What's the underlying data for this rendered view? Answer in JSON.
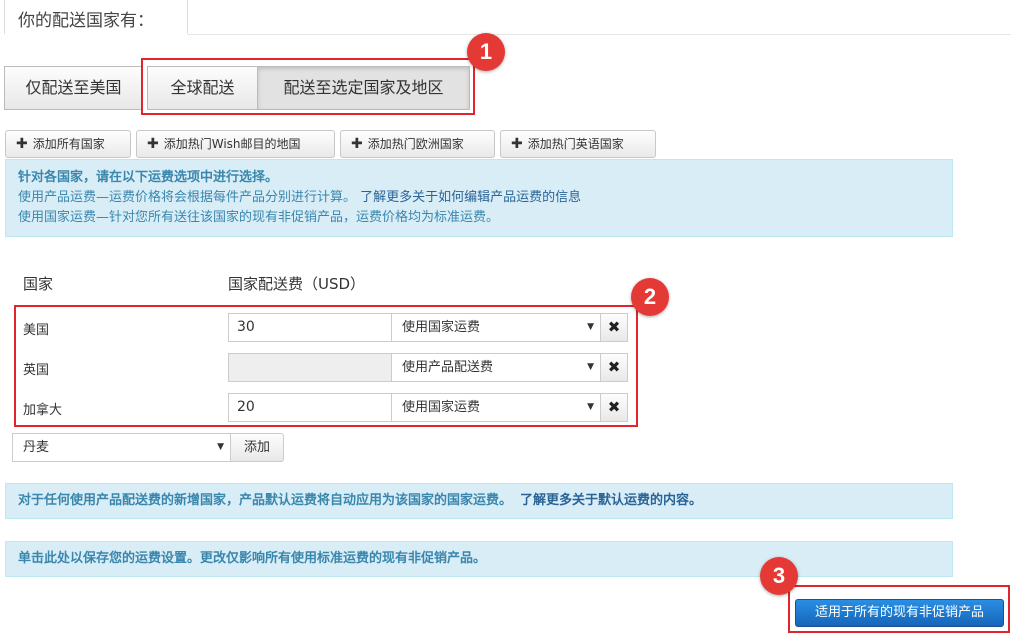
{
  "header": {
    "title": "你的配送国家有："
  },
  "scope_tabs": [
    {
      "label": "仅配送至美国"
    },
    {
      "label": "全球配送"
    },
    {
      "label": "配送至选定国家及地区"
    }
  ],
  "quick_add": [
    {
      "label": "添加所有国家"
    },
    {
      "label": "添加热门Wish邮目的地国"
    },
    {
      "label": "添加热门欧洲国家"
    },
    {
      "label": "添加热门英语国家"
    }
  ],
  "info_box": {
    "heading": "针对各国家，请在以下运费选项中进行选择。",
    "line1_text": "使用产品运费—运费价格将会根据每件产品分别进行计算。",
    "line1_link": "了解更多关于如何编辑产品运费的信息",
    "line2_text": "使用国家运费—针对您所有送往该国家的现有非促销产品，运费价格均为标准运费。"
  },
  "table": {
    "col_country": "国家",
    "col_fee": "国家配送费（USD）",
    "rows": [
      {
        "country": "美国",
        "fee": "30",
        "option": "使用国家运费"
      },
      {
        "country": "英国",
        "fee": "",
        "option": "使用产品配送费"
      },
      {
        "country": "加拿大",
        "fee": "20",
        "option": "使用国家运费"
      }
    ]
  },
  "add_country": {
    "selected": "丹麦",
    "button": "添加"
  },
  "notice_default": {
    "text": "对于任何使用产品配送费的新增国家，产品默认运费将自动应用为该国家的国家运费。",
    "link": "了解更多关于默认运费的内容。"
  },
  "notice_save": {
    "text": "单击此处以保存您的运费设置。更改仅影响所有使用标准运费的现有非促销产品。"
  },
  "apply_button": {
    "label": "适用于所有的现有非促销产品"
  },
  "annotations": [
    {
      "number": "1"
    },
    {
      "number": "2"
    },
    {
      "number": "3"
    }
  ],
  "icons": {
    "plus": "plus-icon",
    "remove": "remove-x-icon",
    "caret": "caret-down-icon"
  },
  "colors": {
    "annotation_red": "#e0262c",
    "info_bg": "#d9edf7",
    "primary_blue": "#1a74cc"
  }
}
